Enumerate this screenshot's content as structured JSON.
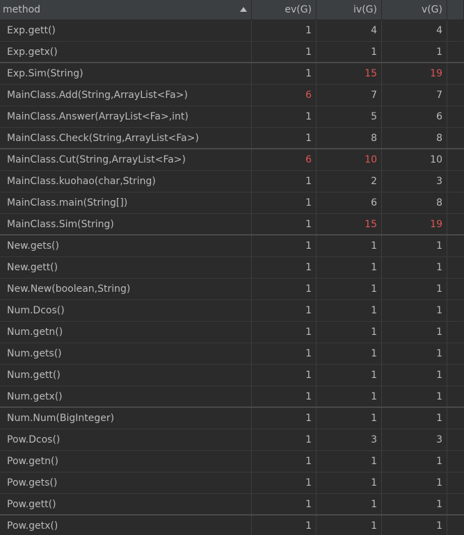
{
  "columns": {
    "method": "method",
    "ev": "ev(G)",
    "iv": "iv(G)",
    "v": "v(G)"
  },
  "colors": {
    "background": "#2b2b2b",
    "header": "#3c3f41",
    "text": "#bbbbbb",
    "highlight": "#e05555"
  },
  "rows": [
    {
      "method": "Exp.gett()",
      "ev": "1",
      "iv": "4",
      "v": "4",
      "ev_red": false,
      "iv_red": false,
      "v_red": false
    },
    {
      "method": "Exp.getx()",
      "ev": "1",
      "iv": "1",
      "v": "1",
      "ev_red": false,
      "iv_red": false,
      "v_red": false
    },
    {
      "method": "Exp.Sim(String)",
      "ev": "1",
      "iv": "15",
      "v": "19",
      "ev_red": false,
      "iv_red": true,
      "v_red": true
    },
    {
      "method": "MainClass.Add(String,ArrayList<Fa>)",
      "ev": "6",
      "iv": "7",
      "v": "7",
      "ev_red": true,
      "iv_red": false,
      "v_red": false
    },
    {
      "method": "MainClass.Answer(ArrayList<Fa>,int)",
      "ev": "1",
      "iv": "5",
      "v": "6",
      "ev_red": false,
      "iv_red": false,
      "v_red": false
    },
    {
      "method": "MainClass.Check(String,ArrayList<Fa>)",
      "ev": "1",
      "iv": "8",
      "v": "8",
      "ev_red": false,
      "iv_red": false,
      "v_red": false
    },
    {
      "method": "MainClass.Cut(String,ArrayList<Fa>)",
      "ev": "6",
      "iv": "10",
      "v": "10",
      "ev_red": true,
      "iv_red": true,
      "v_red": false
    },
    {
      "method": "MainClass.kuohao(char,String)",
      "ev": "1",
      "iv": "2",
      "v": "3",
      "ev_red": false,
      "iv_red": false,
      "v_red": false
    },
    {
      "method": "MainClass.main(String[])",
      "ev": "1",
      "iv": "6",
      "v": "8",
      "ev_red": false,
      "iv_red": false,
      "v_red": false
    },
    {
      "method": "MainClass.Sim(String)",
      "ev": "1",
      "iv": "15",
      "v": "19",
      "ev_red": false,
      "iv_red": true,
      "v_red": true
    },
    {
      "method": "New.gets()",
      "ev": "1",
      "iv": "1",
      "v": "1",
      "ev_red": false,
      "iv_red": false,
      "v_red": false
    },
    {
      "method": "New.gett()",
      "ev": "1",
      "iv": "1",
      "v": "1",
      "ev_red": false,
      "iv_red": false,
      "v_red": false
    },
    {
      "method": "New.New(boolean,String)",
      "ev": "1",
      "iv": "1",
      "v": "1",
      "ev_red": false,
      "iv_red": false,
      "v_red": false
    },
    {
      "method": "Num.Dcos()",
      "ev": "1",
      "iv": "1",
      "v": "1",
      "ev_red": false,
      "iv_red": false,
      "v_red": false
    },
    {
      "method": "Num.getn()",
      "ev": "1",
      "iv": "1",
      "v": "1",
      "ev_red": false,
      "iv_red": false,
      "v_red": false
    },
    {
      "method": "Num.gets()",
      "ev": "1",
      "iv": "1",
      "v": "1",
      "ev_red": false,
      "iv_red": false,
      "v_red": false
    },
    {
      "method": "Num.gett()",
      "ev": "1",
      "iv": "1",
      "v": "1",
      "ev_red": false,
      "iv_red": false,
      "v_red": false
    },
    {
      "method": "Num.getx()",
      "ev": "1",
      "iv": "1",
      "v": "1",
      "ev_red": false,
      "iv_red": false,
      "v_red": false
    },
    {
      "method": "Num.Num(BigInteger)",
      "ev": "1",
      "iv": "1",
      "v": "1",
      "ev_red": false,
      "iv_red": false,
      "v_red": false
    },
    {
      "method": "Pow.Dcos()",
      "ev": "1",
      "iv": "3",
      "v": "3",
      "ev_red": false,
      "iv_red": false,
      "v_red": false
    },
    {
      "method": "Pow.getn()",
      "ev": "1",
      "iv": "1",
      "v": "1",
      "ev_red": false,
      "iv_red": false,
      "v_red": false
    },
    {
      "method": "Pow.gets()",
      "ev": "1",
      "iv": "1",
      "v": "1",
      "ev_red": false,
      "iv_red": false,
      "v_red": false
    },
    {
      "method": "Pow.gett()",
      "ev": "1",
      "iv": "1",
      "v": "1",
      "ev_red": false,
      "iv_red": false,
      "v_red": false
    },
    {
      "method": "Pow.getx()",
      "ev": "1",
      "iv": "1",
      "v": "1",
      "ev_red": false,
      "iv_red": false,
      "v_red": false
    }
  ]
}
